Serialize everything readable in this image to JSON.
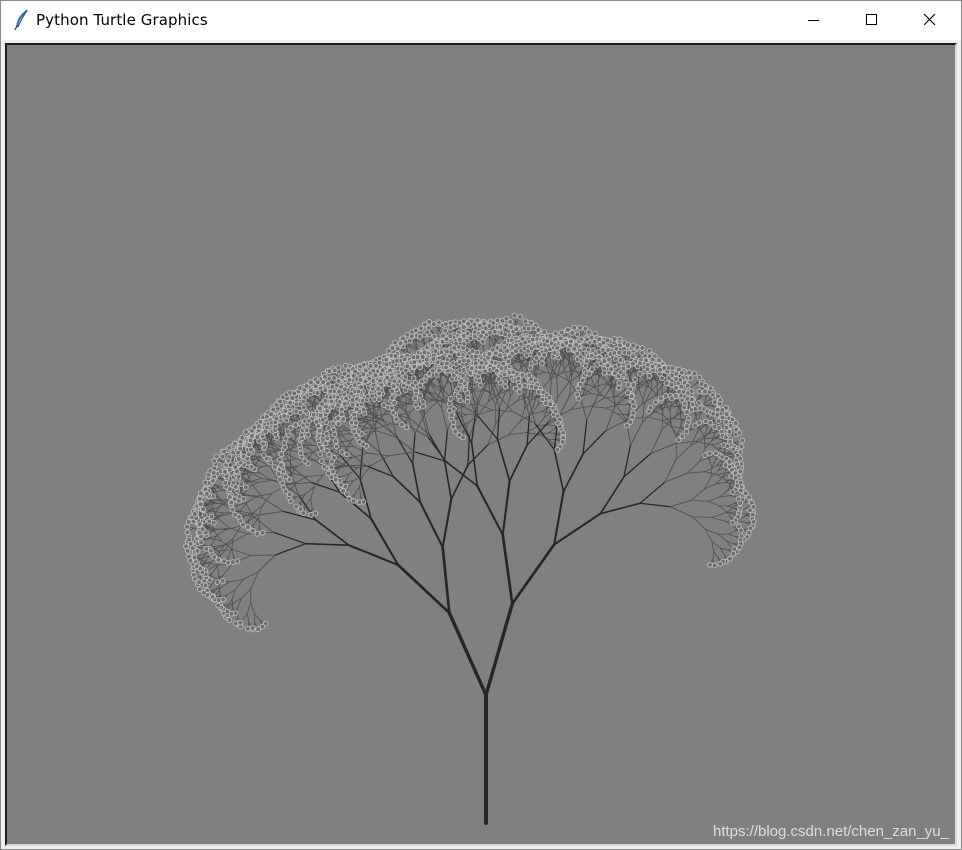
{
  "window": {
    "title": "Python Turtle Graphics",
    "icon": "feather-icon",
    "controls": {
      "minimize": "minimize-icon",
      "maximize": "maximize-icon",
      "close": "close-icon"
    }
  },
  "canvas": {
    "background": "#808080",
    "drawing": "fractal tree",
    "colors": {
      "branch_dark": "#262626",
      "branch_mid": "#4f4f4f",
      "blossom_outline": "#bfbfbf",
      "blossom_fill": "#6e6e6e"
    }
  },
  "watermark": {
    "text": "https://blog.csdn.net/chen_zan_yu_"
  }
}
